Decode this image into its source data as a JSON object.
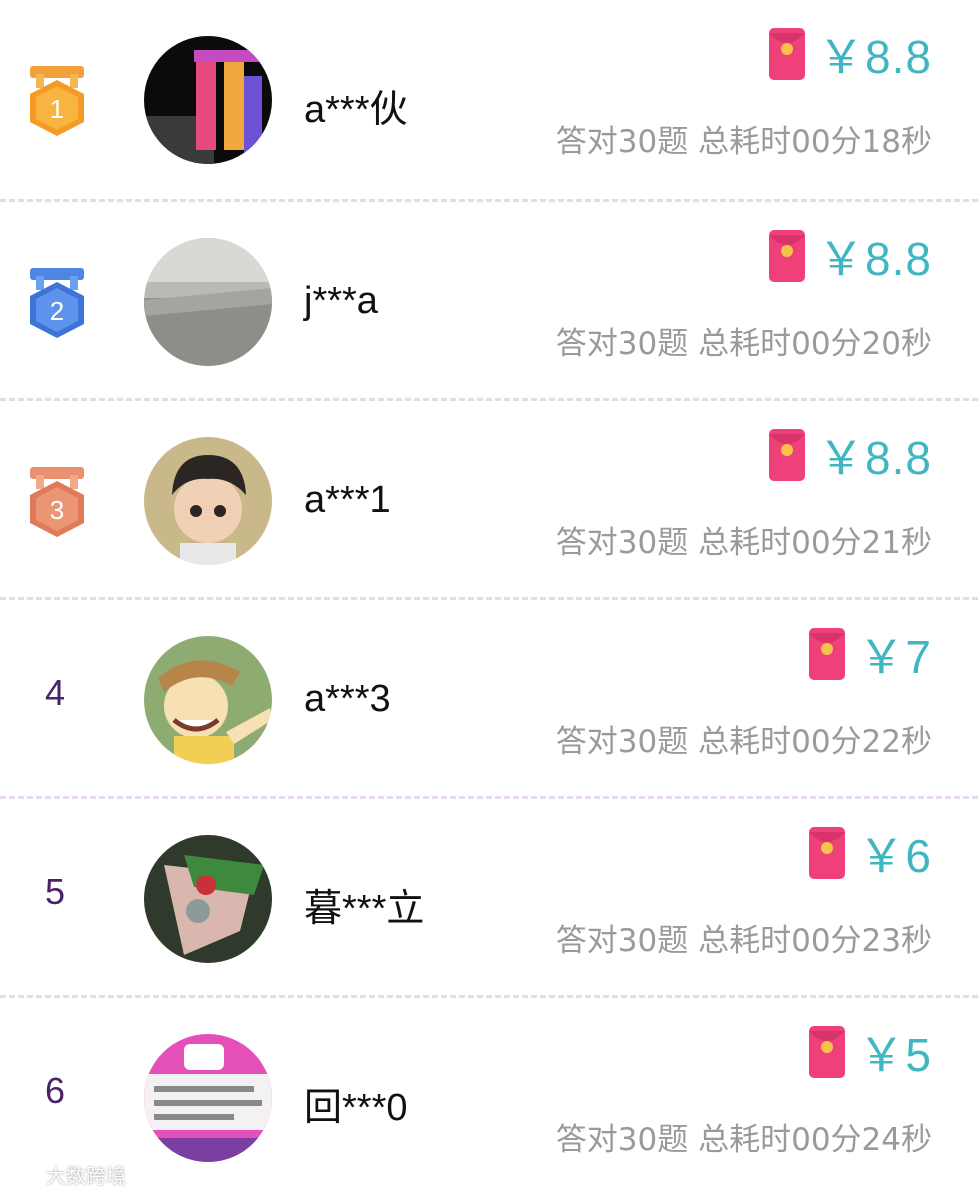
{
  "leaderboard": {
    "rows": [
      {
        "rank": "1",
        "medal": "gold-medal",
        "name": "a***伙",
        "amount": "￥8.8",
        "stats": "答对30题 总耗时00分18秒"
      },
      {
        "rank": "2",
        "medal": "silver-medal",
        "name": "j***a",
        "amount": "￥8.8",
        "stats": "答对30题 总耗时00分20秒"
      },
      {
        "rank": "3",
        "medal": "bronze-medal",
        "name": "a***1",
        "amount": "￥8.8",
        "stats": "答对30题 总耗时00分21秒"
      },
      {
        "rank": "4",
        "name": "a***3",
        "amount": "￥7",
        "stats": "答对30题 总耗时00分22秒"
      },
      {
        "rank": "5",
        "name": "暮***立",
        "amount": "￥6",
        "stats": "答对30题 总耗时00分23秒"
      },
      {
        "rank": "6",
        "name": "回***0",
        "amount": "￥5",
        "stats": "答对30题 总耗时00分24秒"
      }
    ]
  },
  "colors": {
    "amount": "#3fb6c2",
    "rank_number": "#4a2266",
    "envelope": "#f0407a",
    "divider": "#e6d9ee"
  },
  "watermark": {
    "text": "大数跨境",
    "icon": "weibo-icon"
  }
}
